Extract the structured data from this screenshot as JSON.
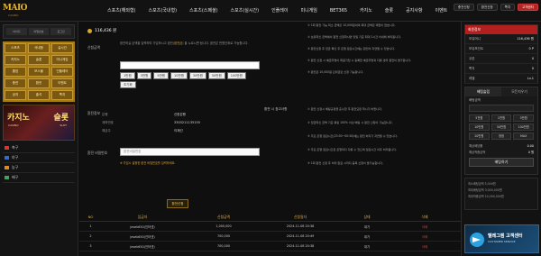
{
  "brand": {
    "logo": "MAIO",
    "logo_sub": "CASINO"
  },
  "nav": [
    "스포츠(해외형)",
    "스포츠(국내형)",
    "스포츠(스페셜)",
    "스포츠(실시간)",
    "인플레이",
    "미니게임",
    "BET365",
    "카지노",
    "슬롯",
    "공지사항",
    "이벤트"
  ],
  "top_right": {
    "charge": "충전신청",
    "exchange": "환전신청",
    "message": "쪽지",
    "support": "고객센터"
  },
  "sidebar_left": {
    "login": [
      "아이디",
      "비밀번호",
      "로그인"
    ],
    "menu": [
      "스포츠",
      "국내형",
      "실시간",
      "카지노",
      "슬롯",
      "미니게임",
      "홀덤",
      "보스몰",
      "인플레이",
      "충전",
      "환전",
      "이벤트",
      "공지",
      "출석",
      "쪽지"
    ],
    "banner": {
      "t1": "카지노",
      "t2": "슬롯",
      "s1": "CASINO",
      "s2": "SLOT"
    },
    "list": [
      "축구",
      "야구",
      "농구",
      "배구"
    ]
  },
  "exchange_form": {
    "balance_value": "116,436 원",
    "amount_label": "신청금액",
    "amount_desc": "환전하실 금액을 입력하여 가입하시고 환전(",
    "amount_desc_hl": "환전금",
    "amount_desc2": ") 을 누르시면 됩니다. 환전은 만원단위로 가능합니다.",
    "amount_buttons": [
      "1만원",
      "3만원",
      "5만원",
      "10만원",
      "30만원",
      "50만원",
      "100만원",
      "초기화"
    ],
    "account_label": "환전정보",
    "account_rows": [
      {
        "k": "은행",
        "v": "신한은행"
      },
      {
        "k": "계좌번호",
        "v": "3303211135155"
      },
      {
        "k": "예금주",
        "v": "이재선"
      }
    ],
    "password_label": "환전 비밀번호",
    "password_placeholder": "환전비밀번호",
    "password_warn": "※ 가입시 설정한 환전 비밀번호를 입력하세요.",
    "submit": "환전신청"
  },
  "notes": {
    "title1": "환전 시 참고사항",
    "n1": "① 1회 환전 가능 최소 금액은 10,000원이며 최대 금액은 제한이 없습니다.",
    "n2": "② 보유하신 금액에서 환전 신청하시면 당일 기준 최대 1시간 이내에 처리됩니다.",
    "n3": "③ 환전신청 후 입금 확인 후 은행 점검시간에는 환전이 지연될 수 있습니다.",
    "n4": "④ 환전 신청 시 예금주명이 회원가입 시 등록한 예금주명과 다를 경우 환전이 불가합니다.",
    "n5": "⑤ 환전은 10,000원 단위로만 신청 가능합니다.",
    "title2": "환전 시 참고사항",
    "n6": "① 환전 신청시 배팅규정을 준수한 후 환전요청 하시기 바랍니다.",
    "n7": "② 입금하신 금액 기준 롤링 100% 이상 배팅 시 환전 신청이 가능합니다.",
    "n8": "③ 주요 은행 점검시간(23:30~00:30)에는 환전 처리가 지연될 수 있습니다.",
    "n9": "④ 주요 은행 점검시간은 은행마다 다를 수 있으며 점검시간 이후 처리됩니다.",
    "n10": "⑤ 1회 환전 신청 후 처리 완료 시까지 중복 신청이 불가능합니다."
  },
  "table": {
    "headers": [
      "NO",
      "입금자",
      "신청금액",
      "신청일자",
      "상태",
      "삭제"
    ],
    "rows": [
      {
        "no": "1",
        "name": "jesek650(인터넷)",
        "amount": "1,000,000",
        "date": "2024-11-08 20:38",
        "status": "대기",
        "del": "삭제"
      },
      {
        "no": "2",
        "name": "jesek650(인터넷)",
        "amount": "700,000",
        "date": "2024-11-08 20:49",
        "status": "대기",
        "del": "삭제"
      },
      {
        "no": "3",
        "name": "jesek650(인터넷)",
        "amount": "700,000",
        "date": "2024-11-08 20:38",
        "status": "대기",
        "del": "삭제"
      }
    ]
  },
  "sidebar_right": {
    "user_head": "회원정보",
    "user_rows": [
      {
        "k": "보유머니",
        "v": "116,436 원"
      },
      {
        "k": "보유포인트",
        "v": "0 P"
      },
      {
        "k": "쿠폰",
        "v": "0"
      },
      {
        "k": "쪽지",
        "v": "0"
      },
      {
        "k": "레벨",
        "v": "Lv.1"
      }
    ],
    "bet_tabs": [
      "배팅슬립",
      "모든지우기"
    ],
    "bet_amount_label": "배팅금액",
    "bet_chips": [
      "5천원",
      "1만원",
      "5만원",
      "10만원",
      "50만원",
      "100만원",
      "20만원",
      "정정",
      "MAX"
    ],
    "bet_lines": [
      {
        "k": "예상배당률",
        "v": "0.00"
      },
      {
        "k": "예상적중금액",
        "v": "0 원"
      }
    ],
    "bet_button": "배팅하기",
    "history": [
      "최소배팅금액 5,000원",
      "최대배팅금액 3,000,000원",
      "최대적중금액 10,000,000원"
    ],
    "tg_title": "텔레그램 고객센터",
    "tg_sub": "CUSTOMER SERVICE"
  },
  "colors": {
    "accent": "#e5a22a",
    "brand_red": "#b21f1f",
    "gold": "#a67c1a"
  }
}
